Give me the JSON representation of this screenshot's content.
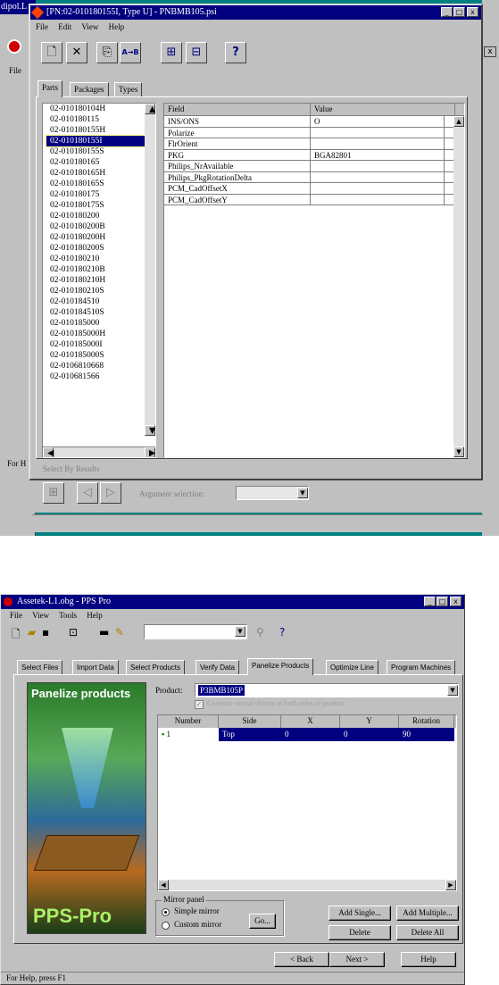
{
  "top": {
    "bg_title": "dipol.L",
    "bg_menu": "File",
    "bg_status": "For H",
    "title": "[PN:02-010180155I, Type U] - PNBMB105.psi",
    "menu": [
      "File",
      "Edit",
      "View",
      "Help"
    ],
    "tabs": [
      "Parts",
      "Packages",
      "Types"
    ],
    "parts": [
      "02-010180104H",
      "02-010180115",
      "02-010180155H",
      "02-010180155I",
      "02-010180155S",
      "02-010180165",
      "02-010180165H",
      "02-010180165S",
      "02-010180175",
      "02-010180175S",
      "02-010180200",
      "02-010180200B",
      "02-010180200H",
      "02-010180200S",
      "02-010180210",
      "02-010180210B",
      "02-010180210H",
      "02-010180210S",
      "02-010184510",
      "02-010184510S",
      "02-010185000",
      "02-010185000H",
      "02-010185000I",
      "02-010185000S",
      "02-0106810668",
      "02-010681566"
    ],
    "selected_index": 3,
    "grid_headers": [
      "Field",
      "Value"
    ],
    "grid_rows": [
      [
        "INS/ONS",
        "O"
      ],
      [
        "Polarize",
        ""
      ],
      [
        "FlrOrient",
        ""
      ],
      [
        "PKG",
        "BGA82801"
      ],
      [
        "Philips_NrAvailable",
        ""
      ],
      [
        "Philips_PkgRotationDelta",
        ""
      ],
      [
        "PCM_CadOffsetX",
        ""
      ],
      [
        "PCM_CadOffsetY",
        ""
      ]
    ],
    "group_label": "Select By Results",
    "argument_label": "Argument selection:",
    "ab_button": "A→B",
    "help_button": "?"
  },
  "bottom": {
    "title": "Assetek-L1.obg - PPS Pro",
    "menu": [
      "File",
      "View",
      "Tools",
      "Help"
    ],
    "tabs": [
      "Select Files",
      "Import Data",
      "Select Products",
      "Verify Data",
      "Panelize Products",
      "Optimize Line",
      "Program Machines"
    ],
    "active_tab": 4,
    "image_title": "Panelize products",
    "brand": "PPS-Pro",
    "product_label": "Product:",
    "product_value": "P3BMB105P",
    "checkbox_label": "Generate virtual objects in both sides of product",
    "table_headers": [
      "Number",
      "Side",
      "X",
      "Y",
      "Rotation"
    ],
    "table_row": [
      "1",
      "Top",
      "0",
      "0",
      "90"
    ],
    "mirror_group": "Mirror panel",
    "mirror_options": [
      "Simple mirror",
      "Custom mirror"
    ],
    "go_button": "Go...",
    "add_single": "Add Single...",
    "add_multiple": "Add Multiple...",
    "delete": "Delete",
    "delete_all": "Delete All",
    "back": "< Back",
    "next": "Next >",
    "help": "Help",
    "status": "For Help, press F1"
  }
}
